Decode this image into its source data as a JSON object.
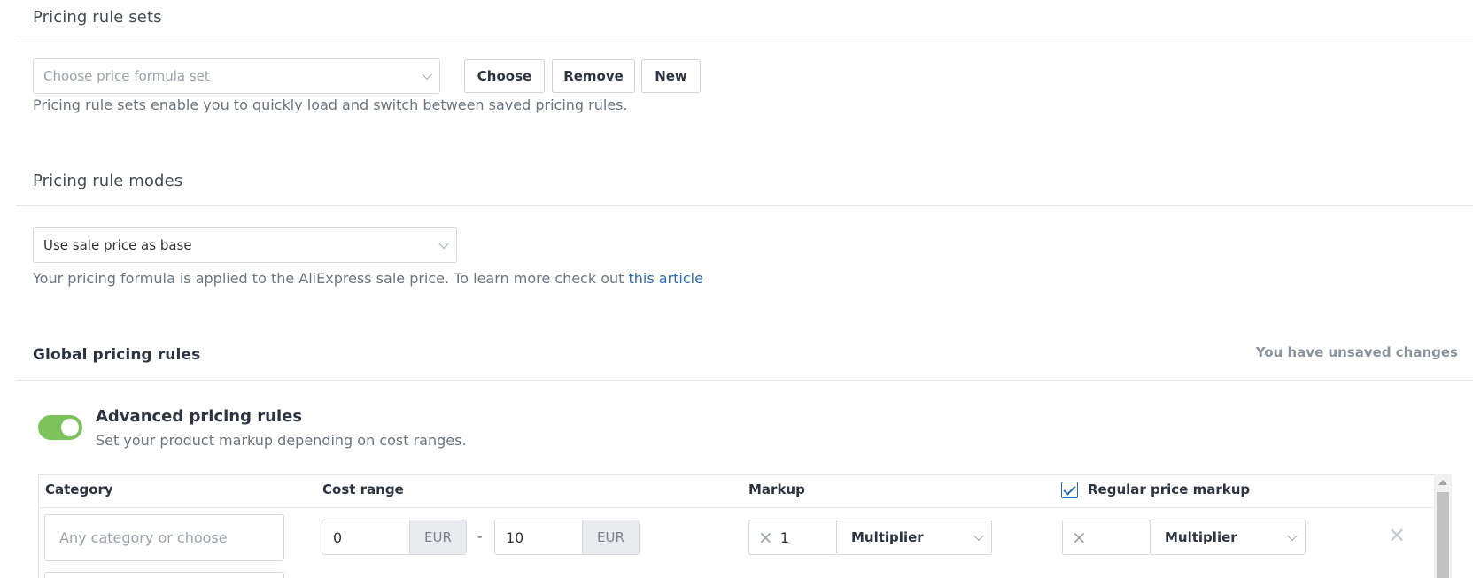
{
  "pricing_rule_sets": {
    "title": "Pricing rule sets",
    "select_placeholder": "Choose price formula set",
    "choose_label": "Choose",
    "remove_label": "Remove",
    "new_label": "New",
    "help_text": "Pricing rule sets enable you to quickly load and switch between saved pricing rules."
  },
  "pricing_rule_modes": {
    "title": "Pricing rule modes",
    "selected_mode": "Use sale price as base",
    "help_text": "Your pricing formula is applied to the AliExpress sale price. To learn more check out ",
    "help_link": "this article"
  },
  "global_pricing_rules": {
    "title": "Global pricing rules",
    "unsaved_notice": "You have unsaved changes",
    "advanced": {
      "enabled": true,
      "title": "Advanced pricing rules",
      "description": "Set your product markup depending on cost ranges."
    },
    "table": {
      "headers": {
        "category": "Category",
        "cost_range": "Cost range",
        "markup": "Markup",
        "regular_price_markup": "Regular price markup"
      },
      "regular_price_markup_checked": true,
      "rows": [
        {
          "category_placeholder": "Any category or choose",
          "cost_min": "0",
          "cost_max": "10",
          "currency": "EUR",
          "range_separator": "-",
          "markup_value": "1",
          "markup_type": "Multiplier",
          "regular_markup_value": "",
          "regular_markup_type": "Multiplier"
        }
      ]
    }
  },
  "icons": {
    "times": "×",
    "remove_row": "✕"
  },
  "colors": {
    "accent": "#2b6cb0",
    "toggle_on": "#7cc35b"
  }
}
